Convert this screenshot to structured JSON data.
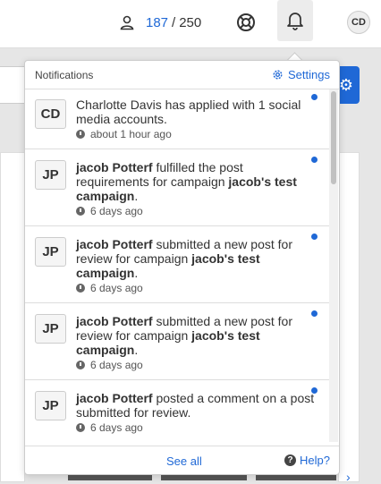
{
  "topbar": {
    "usage_current": "187",
    "usage_sep": "/",
    "usage_total": "250",
    "user_initials": "CD",
    "icons": [
      "user-icon",
      "help-ring-icon",
      "bell-icon"
    ]
  },
  "notifications": {
    "title": "Notifications",
    "settings_label": "Settings",
    "see_all_label": "See all",
    "help_label": "Help?",
    "accent": "#1f68d6",
    "items": [
      {
        "initials": "CD",
        "actor": "",
        "text_parts": [
          {
            "bold": false,
            "t": "Charlotte Davis has applied with 1 social media accounts."
          }
        ],
        "time": "about 1 hour ago",
        "unread": true
      },
      {
        "initials": "JP",
        "text_parts": [
          {
            "bold": true,
            "t": "jacob Potterf"
          },
          {
            "bold": false,
            "t": " fulfilled the post requirements for campaign "
          },
          {
            "bold": true,
            "t": "jacob's test campaign"
          },
          {
            "bold": false,
            "t": "."
          }
        ],
        "time": "6 days ago",
        "unread": true
      },
      {
        "initials": "JP",
        "text_parts": [
          {
            "bold": true,
            "t": "jacob Potterf"
          },
          {
            "bold": false,
            "t": " submitted a new post for review for campaign "
          },
          {
            "bold": true,
            "t": "jacob's test campaign"
          },
          {
            "bold": false,
            "t": "."
          }
        ],
        "time": "6 days ago",
        "unread": true
      },
      {
        "initials": "JP",
        "text_parts": [
          {
            "bold": true,
            "t": "jacob Potterf"
          },
          {
            "bold": false,
            "t": " submitted a new post for review for campaign "
          },
          {
            "bold": true,
            "t": "jacob's test campaign"
          },
          {
            "bold": false,
            "t": "."
          }
        ],
        "time": "6 days ago",
        "unread": true
      },
      {
        "initials": "JP",
        "text_parts": [
          {
            "bold": true,
            "t": "jacob Potterf"
          },
          {
            "bold": false,
            "t": " posted a comment on a post submitted for review."
          }
        ],
        "time": "6 days ago",
        "unread": true
      }
    ]
  }
}
